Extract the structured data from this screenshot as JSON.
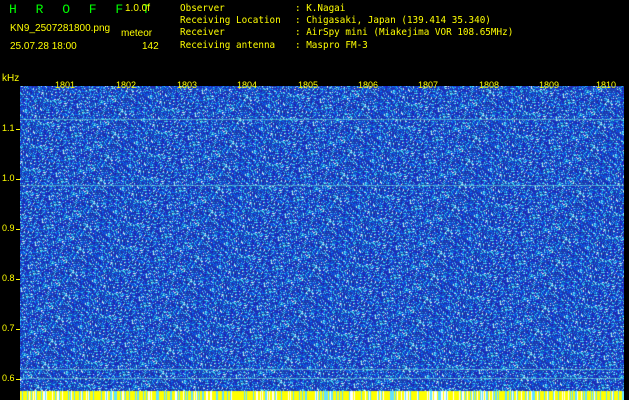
{
  "header": {
    "app_title": "H R O F F T",
    "version": "1.0.0f",
    "filename": "KN9_2507281800.png",
    "mode": "meteor",
    "datetime": "25.07.28 18:00",
    "count": "142"
  },
  "info": [
    {
      "label": "Observer",
      "value": ": K.Nagai"
    },
    {
      "label": "Receiving Location",
      "value": ": Chigasaki, Japan (139.414 35.340)"
    },
    {
      "label": "Receiver",
      "value": ": AirSpy mini (Miakejima VOR 108.65MHz)"
    },
    {
      "label": "Receiving antenna",
      "value": ": Maspro FM-3"
    }
  ],
  "axis": {
    "unit": "kHz",
    "y_labels": [
      "1.1",
      "1.0",
      "0.9",
      "0.8",
      "0.7",
      "0.6"
    ],
    "x_labels": [
      "1801",
      "1802",
      "1803",
      "1804",
      "1805",
      "1806",
      "1807",
      "1808",
      "1809",
      "1810"
    ]
  },
  "colors": {
    "background": "#000000",
    "text": "#ffff00",
    "title": "#00ff00",
    "spectrogram_base": "#1a2cb8",
    "noise_cyan": "#40e0e0",
    "noise_light": "#a0e8ff"
  }
}
